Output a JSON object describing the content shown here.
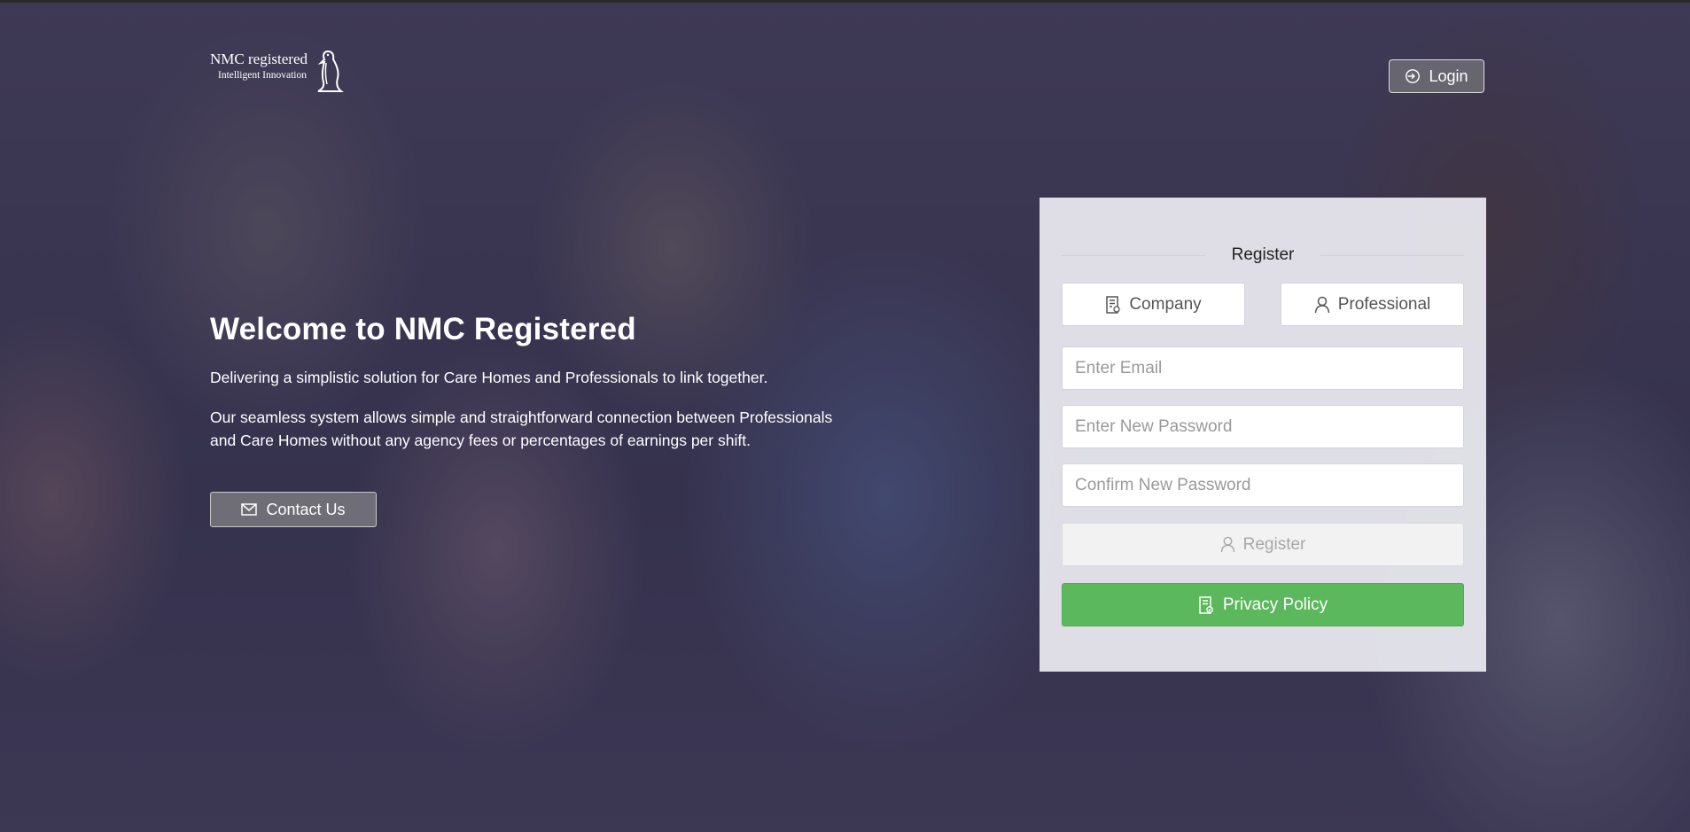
{
  "brand": {
    "name": "NMC registered",
    "tagline": "Intelligent Innovation"
  },
  "header": {
    "login_label": "Login"
  },
  "hero": {
    "title": "Welcome to NMC Registered",
    "subtitle": "Delivering a simplistic solution for Care Homes and Professionals to link together.",
    "description": "Our seamless system allows simple and straightforward connection between Professionals and Care Homes without any agency fees or percentages of earnings per shift.",
    "contact_label": "Contact Us"
  },
  "register": {
    "title": "Register",
    "types": [
      {
        "label": "Company",
        "icon": "building-icon"
      },
      {
        "label": "Professional",
        "icon": "user-icon"
      }
    ],
    "email_placeholder": "Enter Email",
    "password_placeholder": "Enter New Password",
    "confirm_placeholder": "Confirm New Password",
    "register_label": "Register",
    "privacy_label": "Privacy Policy"
  },
  "colors": {
    "privacy_button": "#5cb85c",
    "card_background": "#e8e8ee"
  }
}
